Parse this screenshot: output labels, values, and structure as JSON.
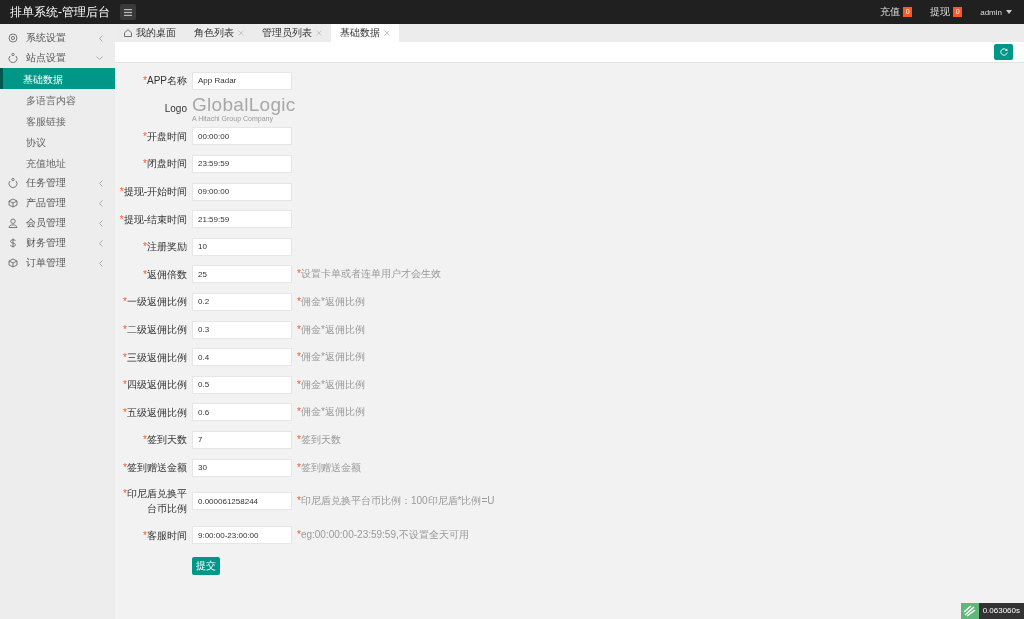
{
  "app": {
    "title": "排单系统-管理后台"
  },
  "topbar": {
    "links": [
      {
        "label": "充值",
        "badge": "0"
      },
      {
        "label": "提现",
        "badge": "0"
      }
    ],
    "user": "admin"
  },
  "sidebar": {
    "items": [
      {
        "label": "系统设置",
        "expanded": false
      },
      {
        "label": "站点设置",
        "expanded": true,
        "children": [
          {
            "label": "基础数据",
            "selected": true
          },
          {
            "label": "多语言内容",
            "selected": false
          },
          {
            "label": "客服链接",
            "selected": false
          },
          {
            "label": "协议",
            "selected": false
          },
          {
            "label": "充值地址",
            "selected": false
          }
        ]
      },
      {
        "label": "任务管理",
        "expanded": false
      },
      {
        "label": "产品管理",
        "expanded": false
      },
      {
        "label": "会员管理",
        "expanded": false
      },
      {
        "label": "财务管理",
        "expanded": false
      },
      {
        "label": "订单管理",
        "expanded": false
      }
    ]
  },
  "tabs": [
    {
      "label": "我的桌面",
      "kind": "home",
      "selected": false
    },
    {
      "label": "角色列表",
      "kind": "closable",
      "selected": false
    },
    {
      "label": "管理员列表",
      "kind": "closable",
      "selected": false
    },
    {
      "label": "基础数据",
      "kind": "closable",
      "selected": true
    }
  ],
  "form": {
    "rows": [
      {
        "kind": "input",
        "mark": "*",
        "label": "APP名称",
        "value": "App Radar"
      },
      {
        "kind": "logo",
        "label": "Logo",
        "logo_name": "GlobalLogic",
        "logo_tagline": "A Hitachi Group Company"
      },
      {
        "kind": "input",
        "mark": "*",
        "label": "开盘时间",
        "value": "00:00:00"
      },
      {
        "kind": "input",
        "mark": "*",
        "label": "闭盘时间",
        "value": "23:59:59"
      },
      {
        "kind": "input",
        "mark": "*",
        "label": "提现-开始时间",
        "value": "09:00:00"
      },
      {
        "kind": "input",
        "mark": "*",
        "label": "提现-结束时间",
        "value": "21:59:59"
      },
      {
        "kind": "input",
        "mark": "*",
        "label": "注册奖励",
        "value": "10"
      },
      {
        "kind": "input",
        "mark": "*",
        "label": "返佣倍数",
        "value": "25",
        "hint_mark": "*",
        "hint": "设置卡单或者连单用户才会生效"
      },
      {
        "kind": "input",
        "mark": "*",
        "label": "一级返佣比例",
        "value": "0.2",
        "hint_mark": "*",
        "hint": "佣金*返佣比例"
      },
      {
        "kind": "input",
        "mark": "*",
        "label": "二级返佣比例",
        "value": "0.3",
        "hint_mark": "*",
        "hint": "佣金*返佣比例"
      },
      {
        "kind": "input",
        "mark": "*",
        "label": "三级返佣比例",
        "value": "0.4",
        "hint_mark": "*",
        "hint": "佣金*返佣比例"
      },
      {
        "kind": "input",
        "mark": "*",
        "label": "四级返佣比例",
        "value": "0.5",
        "hint_mark": "*",
        "hint": "佣金*返佣比例"
      },
      {
        "kind": "input",
        "mark": "*",
        "label": "五级返佣比例",
        "value": "0.6",
        "hint_mark": "*",
        "hint": "佣金*返佣比例"
      },
      {
        "kind": "input",
        "mark": "*",
        "label": "签到天数",
        "value": "7",
        "hint_mark": "*",
        "hint": "签到天数"
      },
      {
        "kind": "input",
        "mark": "*",
        "label": "签到赠送金额",
        "value": "30",
        "hint_mark": "*",
        "hint": "签到赠送金额"
      },
      {
        "kind": "input",
        "mark": "*",
        "label": "印尼盾兑换平台币比例",
        "value": "0.000061258244",
        "hint_mark": "*",
        "hint": "印尼盾兑换平台币比例：100印尼盾*比例=U"
      },
      {
        "kind": "input",
        "mark": "*",
        "label": "客服时间",
        "value": "9:00:00-23:00:00",
        "hint_mark": "*",
        "hint": "eg:00:00:00-23:59:59,不设置全天可用"
      }
    ],
    "submit": "提交"
  },
  "timer": "0.063060s"
}
